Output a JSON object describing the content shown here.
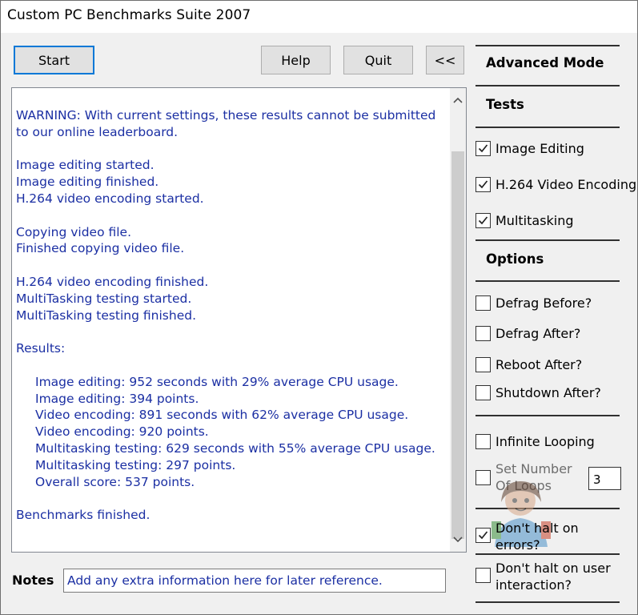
{
  "window": {
    "title": "Custom PC Benchmarks Suite 2007"
  },
  "toolbar": {
    "start_label": "Start",
    "help_label": "Help",
    "quit_label": "Quit",
    "collapse_label": "<<"
  },
  "log": {
    "lines": [
      {
        "text": "WARNING: With current settings, these results cannot be submitted",
        "indent": false
      },
      {
        "text": "to our online leaderboard.",
        "indent": false
      },
      {
        "text": "",
        "indent": false
      },
      {
        "text": "Image editing started.",
        "indent": false
      },
      {
        "text": "Image editing finished.",
        "indent": false
      },
      {
        "text": "H.264 video encoding started.",
        "indent": false
      },
      {
        "text": "",
        "indent": false
      },
      {
        "text": "Copying video file.",
        "indent": false
      },
      {
        "text": "Finished copying video file.",
        "indent": false
      },
      {
        "text": "",
        "indent": false
      },
      {
        "text": "H.264 video encoding finished.",
        "indent": false
      },
      {
        "text": "MultiTasking testing started.",
        "indent": false
      },
      {
        "text": "MultiTasking testing finished.",
        "indent": false
      },
      {
        "text": "",
        "indent": false
      },
      {
        "text": "Results:",
        "indent": false
      },
      {
        "text": "",
        "indent": false
      },
      {
        "text": "Image editing: 952 seconds with 29% average CPU usage.",
        "indent": true
      },
      {
        "text": "Image editing: 394 points.",
        "indent": true
      },
      {
        "text": "Video encoding: 891 seconds with 62% average CPU usage.",
        "indent": true
      },
      {
        "text": "Video encoding: 920 points.",
        "indent": true
      },
      {
        "text": "Multitasking testing: 629 seconds with 55% average CPU usage.",
        "indent": true
      },
      {
        "text": "Multitasking testing: 297 points.",
        "indent": true
      },
      {
        "text": "Overall score: 537 points.",
        "indent": true
      },
      {
        "text": "",
        "indent": false
      },
      {
        "text": "Benchmarks finished.",
        "indent": false
      }
    ]
  },
  "notes": {
    "label": "Notes",
    "value": "Add any extra information here for later reference."
  },
  "sidebar": {
    "mode_title": "Advanced Mode",
    "tests_header": "Tests",
    "tests": [
      {
        "label": "Image Editing",
        "checked": true
      },
      {
        "label": "H.264 Video Encoding",
        "checked": true
      },
      {
        "label": "Multitasking",
        "checked": true
      }
    ],
    "options_header": "Options",
    "options": [
      {
        "label": "Defrag Before?",
        "checked": false
      },
      {
        "label": "Defrag After?",
        "checked": false
      },
      {
        "label": "Reboot After?",
        "checked": false
      },
      {
        "label": "Shutdown After?",
        "checked": false
      }
    ],
    "infinite_looping": {
      "label": "Infinite Looping",
      "checked": false
    },
    "set_loops": {
      "label": "Set Number Of Loops",
      "checked": false,
      "value": "3"
    },
    "dont_halt_errors": {
      "label": "Don't halt on errors?",
      "checked": true
    },
    "dont_halt_user": {
      "label": "Don't halt on user interaction?",
      "checked": false
    }
  },
  "colors": {
    "log_text": "#1b2fa3",
    "accent_border": "#0078d7"
  }
}
